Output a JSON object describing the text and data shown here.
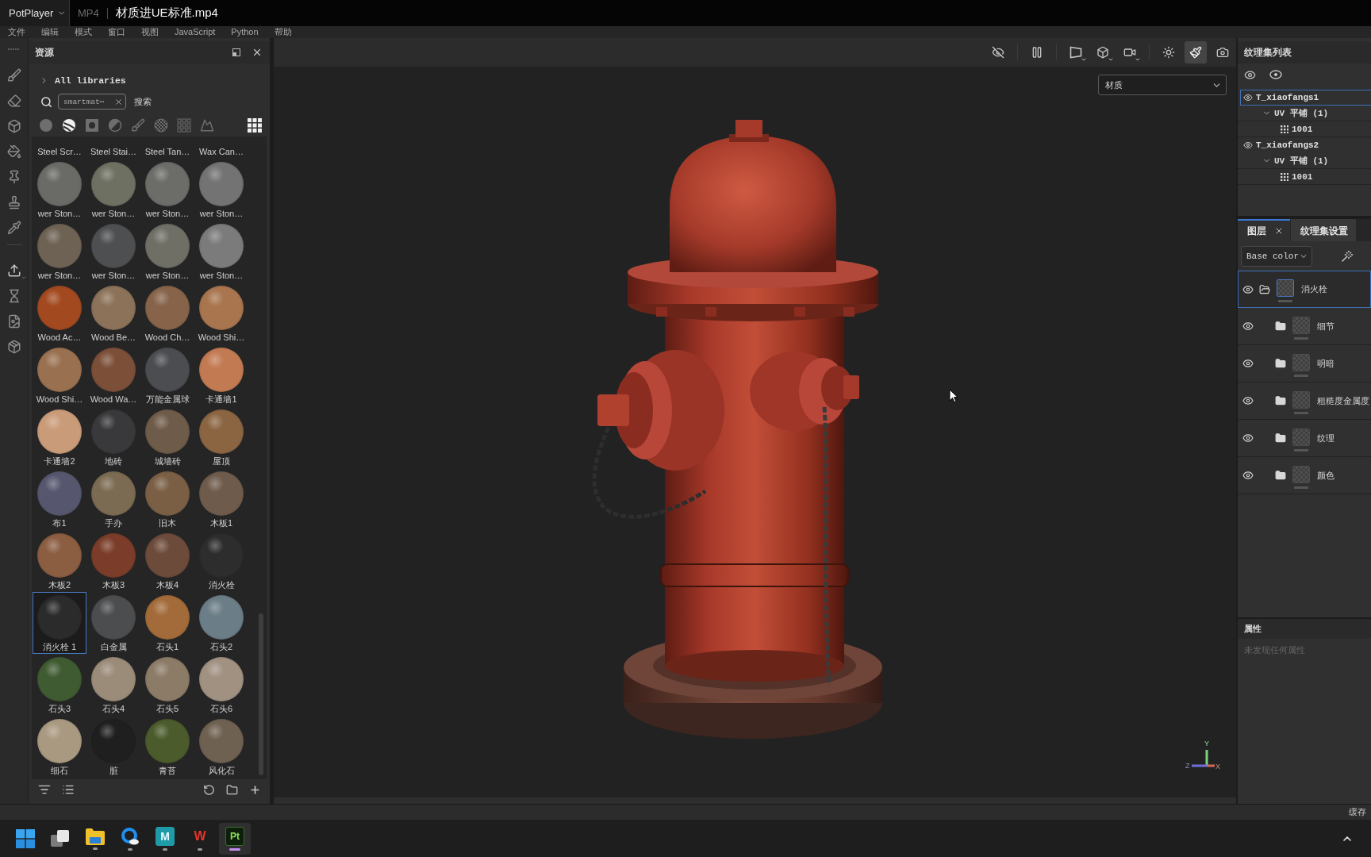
{
  "player_bar": {
    "app": "PotPlayer",
    "format": "MP4",
    "title": "材质进UE标准.mp4"
  },
  "menu": [
    "文件",
    "编辑",
    "模式",
    "窗口",
    "视图",
    "JavaScript",
    "Python",
    "帮助"
  ],
  "assets": {
    "title": "资源",
    "library": "All libraries",
    "search": {
      "value": "smartmat⋯",
      "button": "搜索"
    },
    "filters": [
      {
        "kind": "material",
        "selected": false
      },
      {
        "kind": "smart-material",
        "selected": true
      },
      {
        "kind": "mask",
        "selected": false
      },
      {
        "kind": "filter",
        "selected": false
      },
      {
        "kind": "brush",
        "selected": false
      },
      {
        "kind": "alpha",
        "selected": false
      },
      {
        "kind": "procedural",
        "selected": false
      },
      {
        "kind": "environment",
        "selected": false
      }
    ],
    "cut_row": [
      "Steel Scr…",
      "Steel Stai…",
      "Steel Tan…",
      "Wax Can…"
    ],
    "materials": [
      {
        "name": "wer Ston…",
        "color": "#6a6a66",
        "selected": false
      },
      {
        "name": "wer Ston…",
        "color": "#6e7062",
        "selected": false
      },
      {
        "name": "wer Ston…",
        "color": "#6c6c68",
        "selected": false
      },
      {
        "name": "wer Ston…",
        "color": "#737373",
        "selected": false
      },
      {
        "name": "wer Ston…",
        "color": "#6e6254",
        "selected": false
      },
      {
        "name": "wer Ston…",
        "color": "#4d4f50",
        "selected": false
      },
      {
        "name": "wer Ston…",
        "color": "#6f6f66",
        "selected": false
      },
      {
        "name": "wer Ston…",
        "color": "#7b7b7b",
        "selected": false
      },
      {
        "name": "Wood Ac…",
        "color": "#a2491f",
        "selected": false
      },
      {
        "name": "Wood Be…",
        "color": "#8b7259",
        "selected": false
      },
      {
        "name": "Wood Ch…",
        "color": "#87634a",
        "selected": false
      },
      {
        "name": "Wood Shi…",
        "color": "#a8754e",
        "selected": false
      },
      {
        "name": "Wood Shi…",
        "color": "#9a7150",
        "selected": false
      },
      {
        "name": "Wood Wa…",
        "color": "#7b4f38",
        "selected": false
      },
      {
        "name": "万能金属球",
        "color": "#4b4d51",
        "selected": false
      },
      {
        "name": "卡通墙1",
        "color": "#c27a52",
        "selected": false
      },
      {
        "name": "卡通墙2",
        "color": "#c99b79",
        "selected": false
      },
      {
        "name": "地砖",
        "color": "#39393b",
        "selected": false
      },
      {
        "name": "城墙砖",
        "color": "#6f5b49",
        "selected": false
      },
      {
        "name": "屋顶",
        "color": "#8b6542",
        "selected": false
      },
      {
        "name": "布1",
        "color": "#56566e",
        "selected": false
      },
      {
        "name": "手办",
        "color": "#7b6b52",
        "selected": false
      },
      {
        "name": "旧木",
        "color": "#7a5f45",
        "selected": false
      },
      {
        "name": "木板1",
        "color": "#6f5b4b",
        "selected": false
      },
      {
        "name": "木板2",
        "color": "#8b5d41",
        "selected": false
      },
      {
        "name": "木板3",
        "color": "#7b3d29",
        "selected": false
      },
      {
        "name": "木板4",
        "color": "#6d4b3b",
        "selected": false
      },
      {
        "name": "消火栓",
        "color": "#2d2d2e",
        "selected": false
      },
      {
        "name": "消火栓 1",
        "color": "#2b2b2c",
        "selected": true
      },
      {
        "name": "白金属",
        "color": "#4b4d4f",
        "selected": false
      },
      {
        "name": "石头1",
        "color": "#a26b39",
        "selected": false
      },
      {
        "name": "石头2",
        "color": "#6b7d87",
        "selected": false
      },
      {
        "name": "石头3",
        "color": "#3f5b31",
        "selected": false
      },
      {
        "name": "石头4",
        "color": "#9b8b79",
        "selected": false
      },
      {
        "name": "石头5",
        "color": "#8b7b67",
        "selected": false
      },
      {
        "name": "石头6",
        "color": "#a19181",
        "selected": false
      },
      {
        "name": "细石",
        "color": "#a99981",
        "selected": false
      },
      {
        "name": "脏",
        "color": "#1f1f20",
        "selected": false
      },
      {
        "name": "青苔",
        "color": "#4b5b2b",
        "selected": false
      },
      {
        "name": "风化石",
        "color": "#6f6151",
        "selected": false
      }
    ]
  },
  "viewport": {
    "toolbar": [
      [
        {
          "kind": "hide-ui",
          "selected": false,
          "dropdown": false
        }
      ],
      [
        {
          "kind": "pause",
          "selected": false,
          "dropdown": false
        }
      ],
      [
        {
          "kind": "perspective",
          "selected": false,
          "dropdown": true
        },
        {
          "kind": "display",
          "selected": false,
          "dropdown": true
        },
        {
          "kind": "camera",
          "selected": false,
          "dropdown": true
        }
      ],
      [
        {
          "kind": "lights",
          "selected": false,
          "dropdown": false
        },
        {
          "kind": "paint",
          "selected": true,
          "dropdown": false
        },
        {
          "kind": "screenshot",
          "selected": false,
          "dropdown": false
        }
      ]
    ],
    "mode": "材质",
    "axis_labels": {
      "y": "Y",
      "z": "Z",
      "x": "X"
    }
  },
  "texture_sets": {
    "title": "纹理集列表",
    "sets": [
      {
        "name": "T_xiaofangs1",
        "selected": true,
        "visible": true,
        "uv": {
          "label": "UV 平铺 (1)",
          "expanded": true,
          "tiles": [
            "1001"
          ]
        }
      },
      {
        "name": "T_xiaofangs2",
        "selected": false,
        "visible": true,
        "uv": {
          "label": "UV 平铺 (1)",
          "expanded": true,
          "tiles": [
            "1001"
          ]
        }
      }
    ]
  },
  "layers": {
    "tabs": [
      {
        "label": "图层",
        "selected": true,
        "closable": true
      },
      {
        "label": "纹理集设置",
        "selected": false,
        "closable": false
      }
    ],
    "channel": "Base color",
    "items": [
      {
        "name": "消火栓",
        "selected": true,
        "visible": true,
        "expanded": true,
        "children": [
          {
            "name": "细节",
            "selected": false,
            "visible": true,
            "expanded": false
          },
          {
            "name": "明暗",
            "selected": false,
            "visible": true,
            "expanded": false
          },
          {
            "name": "粗糙度金属度",
            "selected": false,
            "visible": true,
            "expanded": false
          },
          {
            "name": "纹理",
            "selected": false,
            "visible": true,
            "expanded": false
          },
          {
            "name": "颜色",
            "selected": false,
            "visible": true,
            "expanded": false
          }
        ]
      }
    ]
  },
  "properties": {
    "title": "属性",
    "empty": "未发现任何属性"
  },
  "status_bar": {
    "text": "缓存"
  },
  "taskbar": {
    "apps": [
      {
        "kind": "start",
        "open": false,
        "selected": false
      },
      {
        "kind": "task-view",
        "open": false,
        "selected": false
      },
      {
        "kind": "explorer",
        "open": true,
        "selected": false
      },
      {
        "kind": "browser",
        "open": true,
        "selected": false
      },
      {
        "kind": "maya",
        "logo": "M",
        "open": true,
        "selected": false
      },
      {
        "kind": "wps",
        "logo": "W",
        "open": true,
        "selected": false
      },
      {
        "kind": "painter",
        "logo": "Pt",
        "open": true,
        "selected": true
      }
    ]
  }
}
